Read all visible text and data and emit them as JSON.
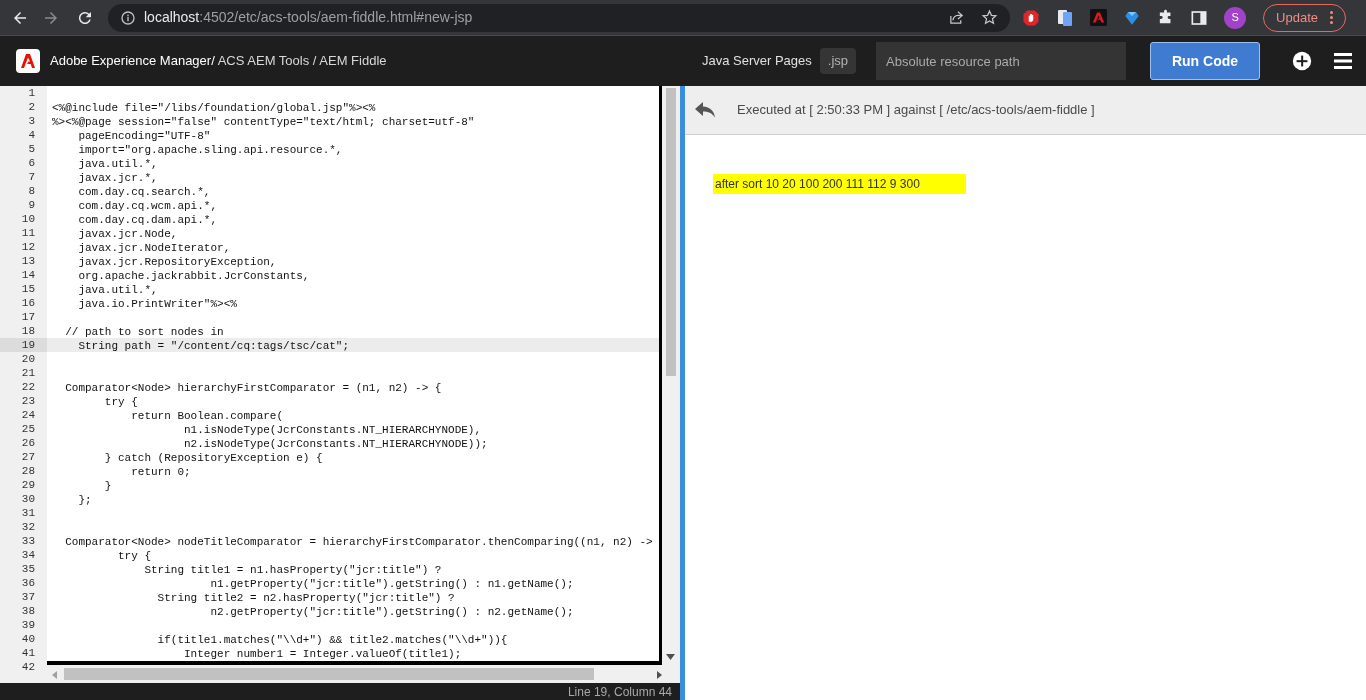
{
  "browser": {
    "url_host": "localhost",
    "url_path": ":4502/etc/acs-tools/aem-fiddle.html#new-jsp",
    "profile_initial": "S",
    "update_button": "Update"
  },
  "header": {
    "title_product": "Adobe Experience Manager/",
    "title_path": " ACS AEM Tools / AEM Fiddle",
    "language": "Java Server Pages",
    "extension": ".jsp",
    "path_field": {
      "placeholder": "Absolute resource path"
    },
    "run_button": "Run Code"
  },
  "editor": {
    "lines": [
      {
        "number": "1",
        "current": false
      },
      {
        "number": "2",
        "text": "<%@include file=\"/libs/foundation/global.jsp\"%><%",
        "current": false
      },
      {
        "number": "3",
        "text": "%><%@page session=\"false\" contentType=\"text/html; charset=utf-8\"",
        "current": false
      },
      {
        "number": "4",
        "text": "    pageEncoding=\"UTF-8\"",
        "current": false
      },
      {
        "number": "5",
        "text": "    import=\"org.apache.sling.api.resource.*,",
        "current": false
      },
      {
        "number": "6",
        "text": "    java.util.*,",
        "current": false
      },
      {
        "number": "7",
        "text": "    javax.jcr.*,",
        "current": false
      },
      {
        "number": "8",
        "text": "    com.day.cq.search.*,",
        "current": false
      },
      {
        "number": "9",
        "text": "    com.day.cq.wcm.api.*,",
        "current": false
      },
      {
        "number": "10",
        "text": "    com.day.cq.dam.api.*,",
        "current": false
      },
      {
        "number": "11",
        "text": "    javax.jcr.Node,",
        "current": false
      },
      {
        "number": "12",
        "text": "    javax.jcr.NodeIterator,",
        "current": false
      },
      {
        "number": "13",
        "text": "    javax.jcr.RepositoryException,",
        "current": false
      },
      {
        "number": "14",
        "text": "    org.apache.jackrabbit.JcrConstants,",
        "current": false
      },
      {
        "number": "15",
        "text": "    java.util.*,",
        "current": false
      },
      {
        "number": "16",
        "text": "    java.io.PrintWriter\"%><%",
        "current": false
      },
      {
        "number": "17",
        "current": false
      },
      {
        "number": "18",
        "text": "  // path to sort nodes in",
        "current": false
      },
      {
        "number": "19",
        "text": "    String path = \"/content/cq:tags/tsc/cat\";",
        "current": true
      },
      {
        "number": "20",
        "current": false
      },
      {
        "number": "21",
        "current": false
      },
      {
        "number": "22",
        "text": "  Comparator<Node> hierarchyFirstComparator = (n1, n2) -> {",
        "current": false
      },
      {
        "number": "23",
        "text": "        try {",
        "current": false
      },
      {
        "number": "24",
        "text": "            return Boolean.compare(",
        "current": false
      },
      {
        "number": "25",
        "text": "                    n1.isNodeType(JcrConstants.NT_HIERARCHYNODE),",
        "current": false
      },
      {
        "number": "26",
        "text": "                    n2.isNodeType(JcrConstants.NT_HIERARCHYNODE));",
        "current": false
      },
      {
        "number": "27",
        "text": "        } catch (RepositoryException e) {",
        "current": false
      },
      {
        "number": "28",
        "text": "            return 0;",
        "current": false
      },
      {
        "number": "29",
        "text": "        }",
        "current": false
      },
      {
        "number": "30",
        "text": "    };",
        "current": false
      },
      {
        "number": "31",
        "current": false
      },
      {
        "number": "32",
        "current": false
      },
      {
        "number": "33",
        "text": "  Comparator<Node> nodeTitleComparator = hierarchyFirstComparator.thenComparing((n1, n2) ->",
        "current": false
      },
      {
        "number": "34",
        "text": "          try {",
        "current": false
      },
      {
        "number": "35",
        "text": "              String title1 = n1.hasProperty(\"jcr:title\") ?",
        "current": false
      },
      {
        "number": "36",
        "text": "                        n1.getProperty(\"jcr:title\").getString() : n1.getName();",
        "current": false
      },
      {
        "number": "37",
        "text": "                String title2 = n2.hasProperty(\"jcr:title\") ?",
        "current": false
      },
      {
        "number": "38",
        "text": "                        n2.getProperty(\"jcr:title\").getString() : n2.getName();",
        "current": false
      },
      {
        "number": "39",
        "current": false
      },
      {
        "number": "40",
        "text": "                if(title1.matches(\"\\\\d+\") && title2.matches(\"\\\\d+\")){",
        "current": false
      },
      {
        "number": "41",
        "text": "                    Integer number1 = Integer.valueOf(title1);",
        "current": false
      },
      {
        "number": "42",
        "current": false
      }
    ],
    "status": "Line 19, Column 44"
  },
  "result": {
    "executed": "Executed at [ 2:50:33 PM ] against [ /etc/acs-tools/aem-fiddle ]",
    "output": "after sort 10 20 100 200 111 112 9 300"
  }
}
